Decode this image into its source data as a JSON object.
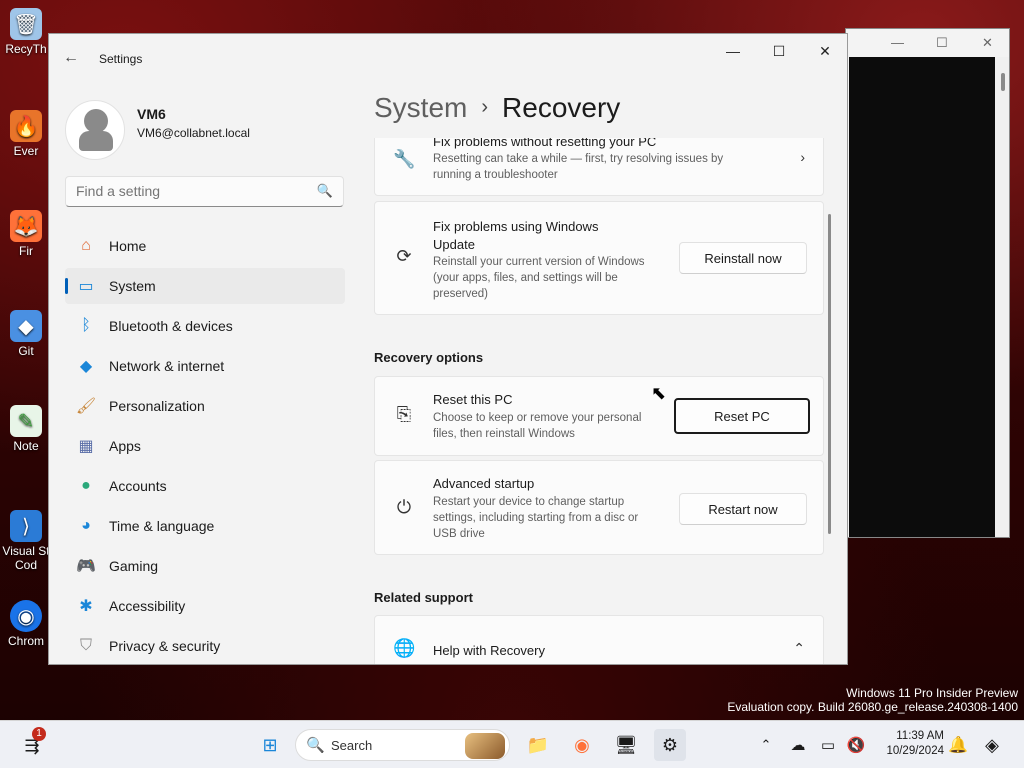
{
  "desktop": {
    "icons": [
      {
        "label": "RecyTh",
        "icon": "recycle-bin-icon",
        "color": "#6fa8dc"
      },
      {
        "label": "Ever",
        "icon": "app-shortcut-icon",
        "color": "#e8742a"
      },
      {
        "label": "Fir",
        "icon": "firefox-icon",
        "color": "#ff7139"
      },
      {
        "label": "Git",
        "icon": "git-icon",
        "color": "#4a90e2"
      },
      {
        "label": "Note",
        "icon": "notepad-icon",
        "color": "#3a9f3a"
      },
      {
        "label": "Visual St Cod",
        "icon": "vscode-icon",
        "color": "#2b7bd6"
      },
      {
        "label": "Chrom",
        "icon": "chrome-icon",
        "color": "#1a73e8"
      }
    ],
    "watermark": {
      "line1": "Windows 11 Pro Insider Preview",
      "line2": "Evaluation copy. Build 26080.ge_release.240308-1400"
    }
  },
  "settings": {
    "app_title": "Settings",
    "user": {
      "name": "VM6",
      "email": "VM6@collabnet.local"
    },
    "search_placeholder": "Find a setting",
    "nav": [
      {
        "label": "Home",
        "icon": "home-icon",
        "active": false
      },
      {
        "label": "System",
        "icon": "system-icon",
        "active": true
      },
      {
        "label": "Bluetooth & devices",
        "icon": "bluetooth-icon",
        "active": false
      },
      {
        "label": "Network & internet",
        "icon": "wifi-icon",
        "active": false
      },
      {
        "label": "Personalization",
        "icon": "brush-icon",
        "active": false
      },
      {
        "label": "Apps",
        "icon": "apps-icon",
        "active": false
      },
      {
        "label": "Accounts",
        "icon": "accounts-icon",
        "active": false
      },
      {
        "label": "Time & language",
        "icon": "globe-clock-icon",
        "active": false
      },
      {
        "label": "Gaming",
        "icon": "gamepad-icon",
        "active": false
      },
      {
        "label": "Accessibility",
        "icon": "accessibility-icon",
        "active": false
      },
      {
        "label": "Privacy & security",
        "icon": "shield-icon",
        "active": false
      }
    ],
    "breadcrumb": {
      "parent": "System",
      "separator": "›",
      "current": "Recovery"
    },
    "cards": {
      "fix_troubleshoot": {
        "title": "Fix problems without resetting your PC",
        "desc": "Resetting can take a while — first, try resolving issues by running a troubleshooter"
      },
      "fix_update": {
        "title": "Fix problems using Windows Update",
        "desc": "Reinstall your current version of Windows (your apps, files, and settings will be preserved)",
        "button": "Reinstall now"
      },
      "recovery_options_heading": "Recovery options",
      "reset_pc": {
        "title": "Reset this PC",
        "desc": "Choose to keep or remove your personal files, then reinstall Windows",
        "button": "Reset PC"
      },
      "advanced_startup": {
        "title": "Advanced startup",
        "desc": "Restart your device to change startup settings, including starting from a disc or USB drive",
        "button": "Restart now"
      },
      "related_support_heading": "Related support",
      "help_recovery": {
        "title": "Help with Recovery"
      }
    }
  },
  "taskbar": {
    "search_label": "Search",
    "notification_count": "1",
    "time": "11:39 AM",
    "date": "10/29/2024"
  }
}
